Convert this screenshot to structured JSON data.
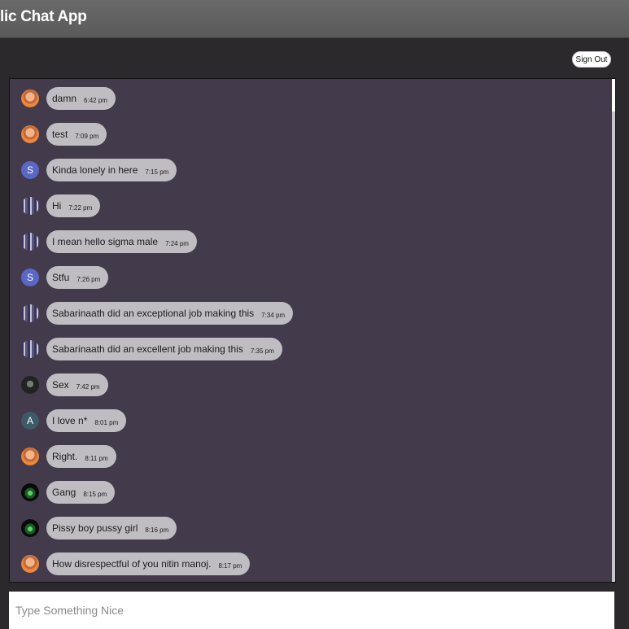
{
  "header": {
    "title": "lic Chat App"
  },
  "controls": {
    "sign_out_label": "Sign Out"
  },
  "composer": {
    "placeholder": "Type Something Nice"
  },
  "messages": [
    {
      "avatar": "photo-a",
      "letter": "",
      "text": "damn",
      "time": "6:42 pm"
    },
    {
      "avatar": "photo-a",
      "letter": "",
      "text": "test",
      "time": "7:09 pm"
    },
    {
      "avatar": "letter-s",
      "letter": "S",
      "text": "Kinda lonely in here",
      "time": "7:15 pm"
    },
    {
      "avatar": "photo-b",
      "letter": "",
      "text": "Hi",
      "time": "7:22 pm"
    },
    {
      "avatar": "photo-b",
      "letter": "",
      "text": "I mean hello sigma male",
      "time": "7:24 pm"
    },
    {
      "avatar": "letter-s",
      "letter": "S",
      "text": "Stfu",
      "time": "7:26 pm"
    },
    {
      "avatar": "photo-b",
      "letter": "",
      "text": "Sabarinaath did an exceptional job making this",
      "time": "7:34 pm"
    },
    {
      "avatar": "photo-b",
      "letter": "",
      "text": "Sabarinaath did an excellent job making this",
      "time": "7:35 pm"
    },
    {
      "avatar": "photo-c",
      "letter": "",
      "text": "Sex",
      "time": "7:42 pm"
    },
    {
      "avatar": "letter-a",
      "letter": "A",
      "text": "I love n*",
      "time": "8:01 pm"
    },
    {
      "avatar": "photo-a",
      "letter": "",
      "text": "Right.",
      "time": "8:11 pm"
    },
    {
      "avatar": "photo-d",
      "letter": "",
      "text": "Gang",
      "time": "8:15 pm"
    },
    {
      "avatar": "photo-d",
      "letter": "",
      "text": "Pissy boy pussy girl",
      "time": "8:16 pm"
    },
    {
      "avatar": "photo-a",
      "letter": "",
      "text": "How disrespectful of you nitin manoj.",
      "time": "8:17 pm"
    }
  ]
}
